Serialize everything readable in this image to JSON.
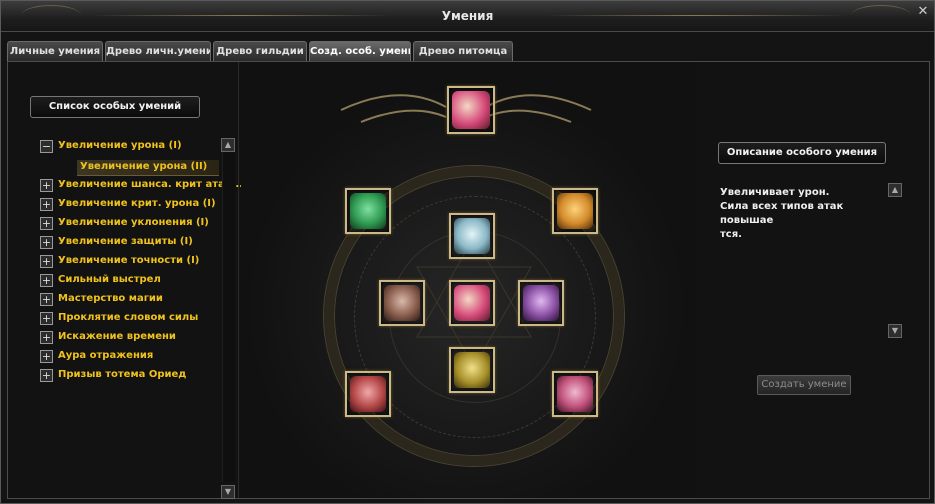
{
  "window": {
    "title": "Умения",
    "close": "✕"
  },
  "tabs": [
    {
      "label": "Личные умения"
    },
    {
      "label": "Древо личн.умений"
    },
    {
      "label": "Древо гильдии"
    },
    {
      "label": "Созд. особ. умения",
      "active": true
    },
    {
      "label": "Древо питомца"
    }
  ],
  "left": {
    "header": "Список особых умений",
    "tree": [
      {
        "toggle": "−",
        "label": "Увеличение урона (I)"
      },
      {
        "toggle": "+",
        "label": "Увеличение шанса. крит атак..."
      },
      {
        "toggle": "+",
        "label": "Увеличение крит. урона (I)"
      },
      {
        "toggle": "+",
        "label": "Увеличение уклонения (I)"
      },
      {
        "toggle": "+",
        "label": "Увеличение защиты (I)"
      },
      {
        "toggle": "+",
        "label": "Увеличение точности (I)"
      },
      {
        "toggle": "+",
        "label": "Сильный выстрел"
      },
      {
        "toggle": "+",
        "label": "Мастерство магии"
      },
      {
        "toggle": "+",
        "label": "Проклятие словом силы"
      },
      {
        "toggle": "+",
        "label": "Искажение времени"
      },
      {
        "toggle": "+",
        "label": "Аура отражения"
      },
      {
        "toggle": "+",
        "label": "Призыв тотема Ориед"
      }
    ],
    "selected_child": "Увеличение урона (II)",
    "scroll_up": "▲",
    "scroll_down": "▼"
  },
  "center": {
    "tiles": [
      {
        "name": "result-skill-icon",
        "color": "#d64a7a"
      },
      {
        "name": "skill-icon-green",
        "color": "#2f9a52"
      },
      {
        "name": "skill-icon-orange",
        "color": "#d28a2a"
      },
      {
        "name": "skill-icon-blue",
        "color": "#8ab8c6"
      },
      {
        "name": "skill-icon-bronze",
        "color": "#8a5e4e"
      },
      {
        "name": "skill-icon-center-damage",
        "color": "#d64a7a"
      },
      {
        "name": "skill-icon-purple",
        "color": "#8a4fa3"
      },
      {
        "name": "skill-icon-gold",
        "color": "#a8902a"
      },
      {
        "name": "skill-icon-red",
        "color": "#b54848"
      },
      {
        "name": "skill-icon-pink",
        "color": "#c0507a"
      }
    ]
  },
  "right": {
    "header": "Описание особого умения",
    "description_line1": "Увеличивает урон.",
    "description_line2": "Сила всех типов атак повышае",
    "description_line3": "тся.",
    "scroll_up": "▲",
    "scroll_down": "▼",
    "create_button": "Создать умение"
  }
}
